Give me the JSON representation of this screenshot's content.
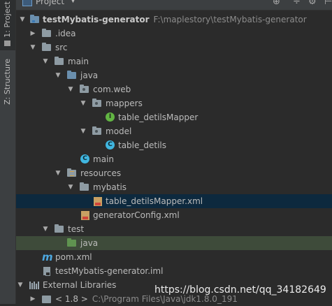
{
  "window": {
    "title": "Project",
    "side_tabs": [
      {
        "label": "1: Project"
      },
      {
        "label": "Z: Structure"
      }
    ],
    "toolbar_icons": [
      "target-icon",
      "gear-icon",
      "hide-icon"
    ]
  },
  "tree": {
    "rows": [
      {
        "label": "testMybatis-generator",
        "path": "F:\\maplestory\\testMybatis-generator",
        "icon": "module-folder-icon",
        "expanded": true
      },
      {
        "label": ".idea",
        "icon": "folder-icon",
        "expanded": false
      },
      {
        "label": "src",
        "icon": "folder-icon",
        "expanded": true
      },
      {
        "label": "main",
        "icon": "folder-icon",
        "expanded": true
      },
      {
        "label": "java",
        "icon": "source-folder-icon",
        "expanded": true
      },
      {
        "label": "com.web",
        "icon": "package-icon",
        "expanded": true
      },
      {
        "label": "mappers",
        "icon": "package-icon",
        "expanded": true
      },
      {
        "label": "table_detilsMapper",
        "icon": "interface-icon",
        "badge": "I"
      },
      {
        "label": "model",
        "icon": "package-icon",
        "expanded": true
      },
      {
        "label": "table_detils",
        "icon": "class-icon",
        "badge": "C"
      },
      {
        "label": "main",
        "icon": "class-icon",
        "badge": "C"
      },
      {
        "label": "resources",
        "icon": "resources-folder-icon",
        "expanded": true
      },
      {
        "label": "mybatis",
        "icon": "folder-icon",
        "expanded": true
      },
      {
        "label": "table_detilsMapper.xml",
        "icon": "xml-file-icon",
        "selected": true
      },
      {
        "label": "generatorConfig.xml",
        "icon": "xml-file-icon"
      },
      {
        "label": "test",
        "icon": "folder-icon",
        "expanded": true
      },
      {
        "label": "java",
        "icon": "test-folder-icon"
      },
      {
        "label": "pom.xml",
        "icon": "maven-icon",
        "badge": "m"
      },
      {
        "label": "testMybatis-generator.iml",
        "icon": "iml-file-icon"
      },
      {
        "label": "External Libraries",
        "icon": "libraries-icon",
        "expanded": true
      },
      {
        "label": "< 1.8 >",
        "path": "C:\\Program Files\\Java\\jdk1.8.0_191",
        "icon": "jdk-icon",
        "expanded": false
      }
    ]
  },
  "watermark": "https://blog.csdn.net/qq_34182649"
}
